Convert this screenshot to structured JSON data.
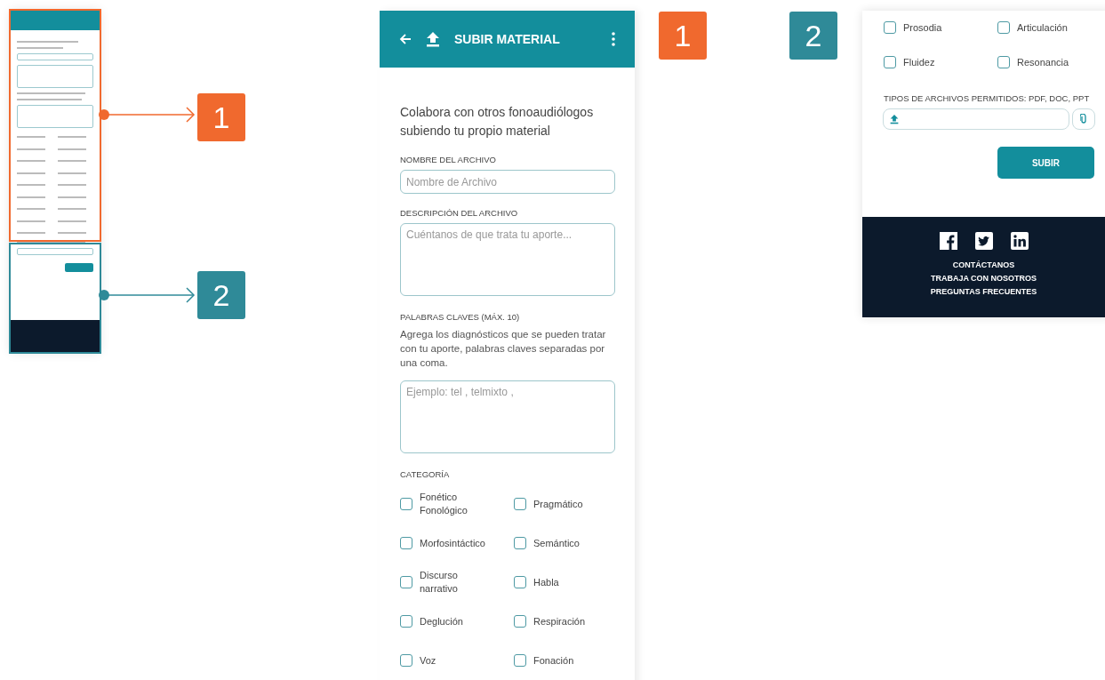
{
  "callouts": [
    {
      "label": "1",
      "color": "#f0692e"
    },
    {
      "label": "2",
      "color": "#2f8a98"
    },
    {
      "label": "1",
      "color": "#f0692e"
    },
    {
      "label": "2",
      "color": "#2f8a98"
    }
  ],
  "screen": {
    "title": "SUBIR MATERIAL",
    "intro": "Colabora con otros fonoaudiólogos subiendo tu propio material",
    "fields": [
      {
        "kind": "input",
        "label": "NOMBRE DEL ARCHIVO",
        "placeholder": "Nombre de Archivo"
      },
      {
        "kind": "textarea",
        "label": "DESCRIPCIÓN DEL ARCHIVO",
        "placeholder": "Cuéntanos de que trata tu aporte..."
      },
      {
        "kind": "textarea",
        "label": "PALABRAS CLAVES (MÁX. 10)",
        "hint": "Agrega los diagnósticos que se pueden tratar con tu aporte, palabras claves separadas por una coma.",
        "placeholder": "Ejemplo: tel , telmixto ,"
      }
    ],
    "category_label": "CATEGORÍA",
    "categories": [
      {
        "label": "Fonético\nFonológico",
        "checked": false
      },
      {
        "label": "Pragmático",
        "checked": false
      },
      {
        "label": "Morfosintáctico",
        "checked": false
      },
      {
        "label": "Semántico",
        "checked": false
      },
      {
        "label": "Discurso\nnarrativo",
        "checked": false
      },
      {
        "label": "Habla",
        "checked": false
      },
      {
        "label": "Deglución",
        "checked": false
      },
      {
        "label": "Respiración",
        "checked": false
      },
      {
        "label": "Voz",
        "checked": false
      },
      {
        "label": "Fonación",
        "checked": false
      }
    ]
  },
  "detail": {
    "categories": [
      {
        "label": "Prosodia",
        "checked": false
      },
      {
        "label": "Articulación",
        "checked": false
      },
      {
        "label": "Fluidez",
        "checked": false
      },
      {
        "label": "Resonancia",
        "checked": false
      }
    ],
    "file_label": "TIPOS DE ARCHIVOS PERMITIDOS: PDF, DOC, PPT",
    "submit": "SUBIR",
    "footer_links": [
      "CONTÁCTANOS",
      "TRABAJA CON NOSOTROS",
      "PREGUNTAS FRECUENTES"
    ]
  }
}
